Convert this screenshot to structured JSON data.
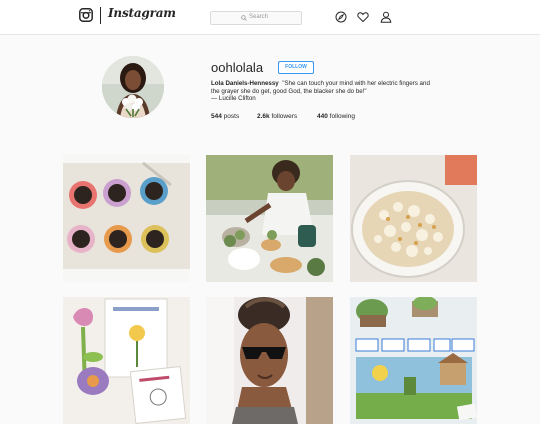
{
  "nav": {
    "logo_text": "Instagram",
    "search_placeholder": "Search",
    "icons": [
      "instagram-camera-icon",
      "search-icon",
      "explore-compass-icon",
      "activity-heart-icon",
      "profile-person-icon"
    ]
  },
  "profile": {
    "username": "oohlolala",
    "follow_label": "FOLLOW",
    "full_name": "Lola Daniels-Hennessy",
    "bio_quote": "\"She can touch your mind with her electric fingers and the grayer she do get, good God, the blacker she do be!\"",
    "bio_attribution": "— Lucille Clifton",
    "posts_count": "544",
    "posts_label": "posts",
    "followers_count": "2.6k",
    "followers_label": "followers",
    "following_count": "440",
    "following_label": "following"
  },
  "posts": [
    {
      "subject": "painted-egg-carton-planters"
    },
    {
      "subject": "child-planting-succulents"
    },
    {
      "subject": "bowl-of-popcorn"
    },
    {
      "subject": "flower-craft-worksheets"
    },
    {
      "subject": "woman-in-sunglasses-selfie"
    },
    {
      "subject": "plant-lifecycle-classroom-poster"
    }
  ],
  "colors": {
    "accent": "#3897f0",
    "background": "#fafafa",
    "text": "#262626",
    "border": "#dbdbdb"
  }
}
